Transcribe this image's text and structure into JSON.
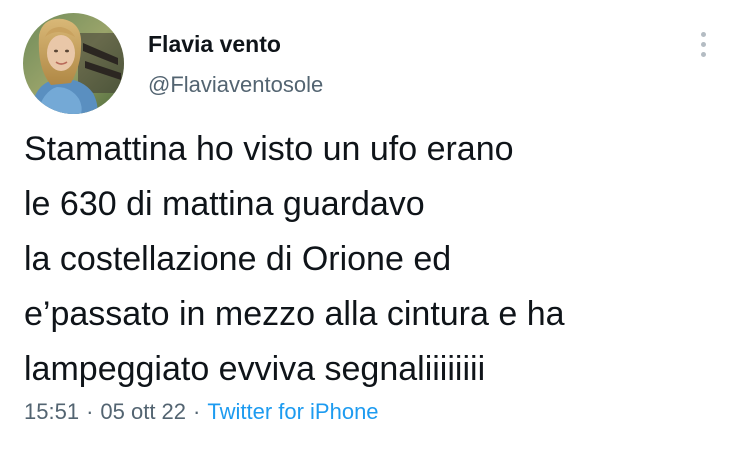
{
  "author": {
    "display_name": "Flavia vento",
    "handle": "@Flaviaventosole",
    "avatar": "profile-photo"
  },
  "menu": {
    "icon": "more-vertical-icon"
  },
  "tweet": {
    "lines": [
      "Stamattina ho visto un ufo erano",
      "le 630 di mattina guardavo",
      "la costellazione di Orione ed",
      "e’passato in mezzo alla cintura e ha",
      "lampeggiato evviva segnaliiiiiiii"
    ]
  },
  "meta": {
    "time": "15:51",
    "separator": "·",
    "date": "05 ott 22",
    "source": "Twitter for iPhone"
  },
  "colors": {
    "text": "#0f1419",
    "secondary": "#536471",
    "link": "#1d9bf0"
  }
}
